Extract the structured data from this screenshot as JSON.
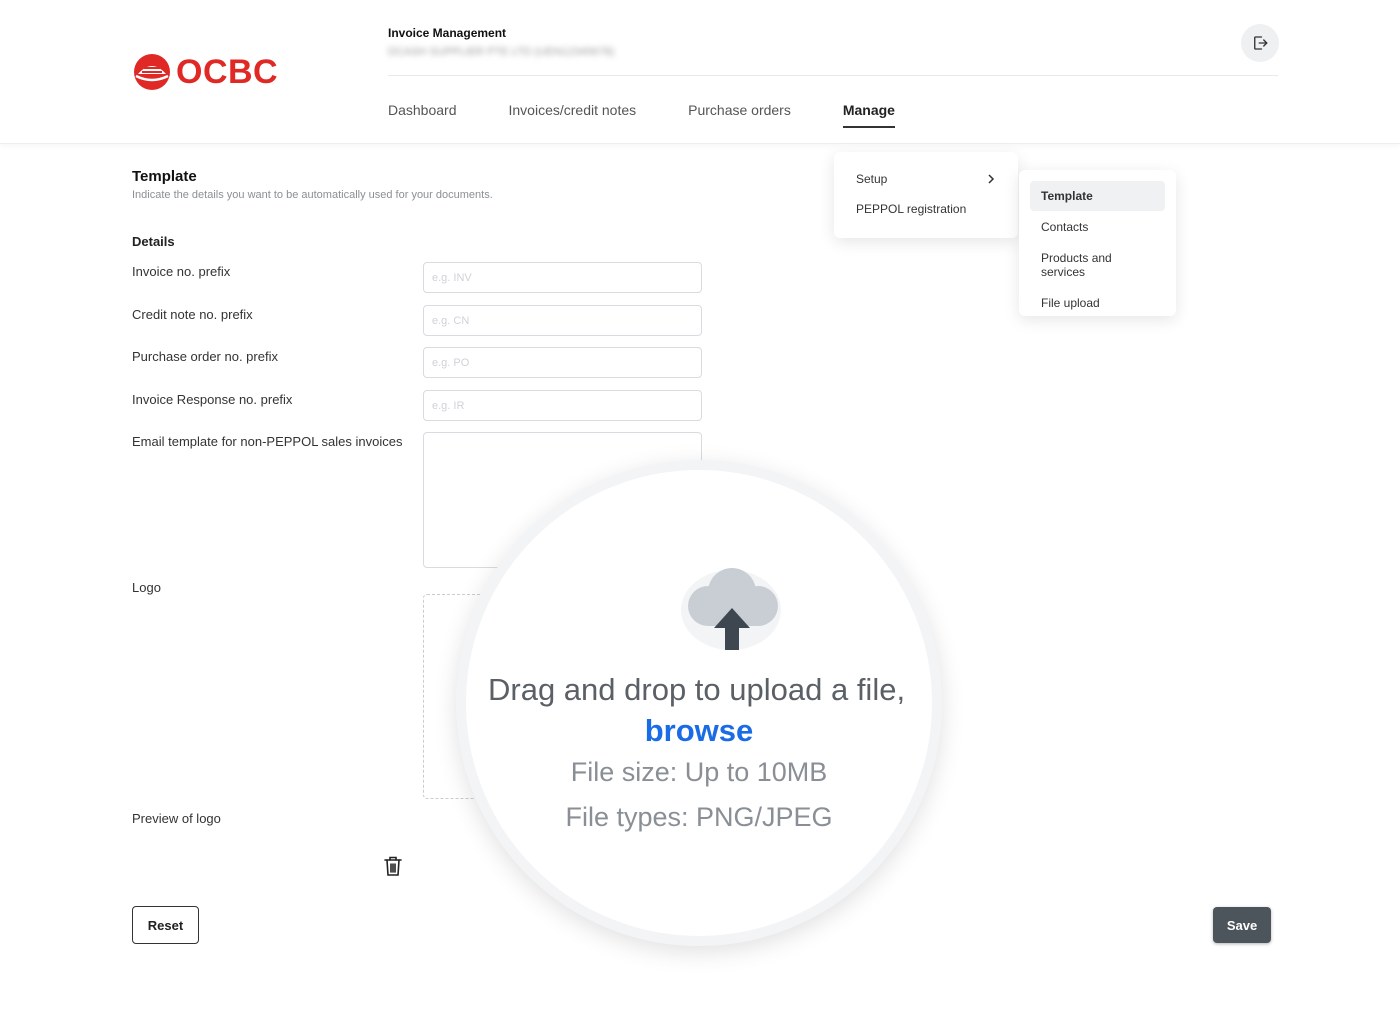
{
  "brand": {
    "name": "OCBC",
    "color": "#e02925"
  },
  "header": {
    "app_title": "Invoice Management",
    "app_subtitle": "DCASH SUPPLIER PTE LTD  (UEN12345678)",
    "logout_icon": "logout-icon"
  },
  "nav": {
    "items": [
      {
        "label": "Dashboard"
      },
      {
        "label": "Invoices/credit notes"
      },
      {
        "label": "Purchase orders"
      },
      {
        "label": "Manage"
      }
    ],
    "active": "Manage"
  },
  "manage_menu": {
    "items": [
      {
        "label": "Setup"
      },
      {
        "label": "PEPPOL registration"
      }
    ]
  },
  "setup_submenu": {
    "items": [
      {
        "label": "Template"
      },
      {
        "label": "Contacts"
      },
      {
        "label": "Products and services"
      },
      {
        "label": "File upload"
      }
    ]
  },
  "page": {
    "title": "Template",
    "description": "Indicate the details you want to be automatically used for your documents.",
    "details_label": "Details"
  },
  "form": {
    "invoice_prefix": {
      "label": "Invoice no. prefix",
      "placeholder": "e.g. INV",
      "value": ""
    },
    "credit_note_prefix": {
      "label": "Credit note no. prefix",
      "placeholder": "e.g. CN",
      "value": ""
    },
    "purchase_order_prefix": {
      "label": "Purchase order no. prefix",
      "placeholder": "e.g. PO",
      "value": ""
    },
    "invoice_response_prefix": {
      "label": "Invoice Response no. prefix",
      "placeholder": "e.g. IR",
      "value": ""
    },
    "email_template": {
      "label": "Email template for non-PEPPOL sales invoices",
      "value": ""
    },
    "logo_label": "Logo",
    "preview_label": "Preview of logo"
  },
  "upload": {
    "drag_text": "Drag and drop to upload a file,",
    "browse_text": "browse",
    "size_text": "File size: Up to 10MB",
    "types_text": "File types: PNG/JPEG"
  },
  "actions": {
    "reset_label": "Reset",
    "save_label": "Save"
  },
  "colors": {
    "save_button": "#4d555c",
    "browse_link": "#1a6be6"
  }
}
